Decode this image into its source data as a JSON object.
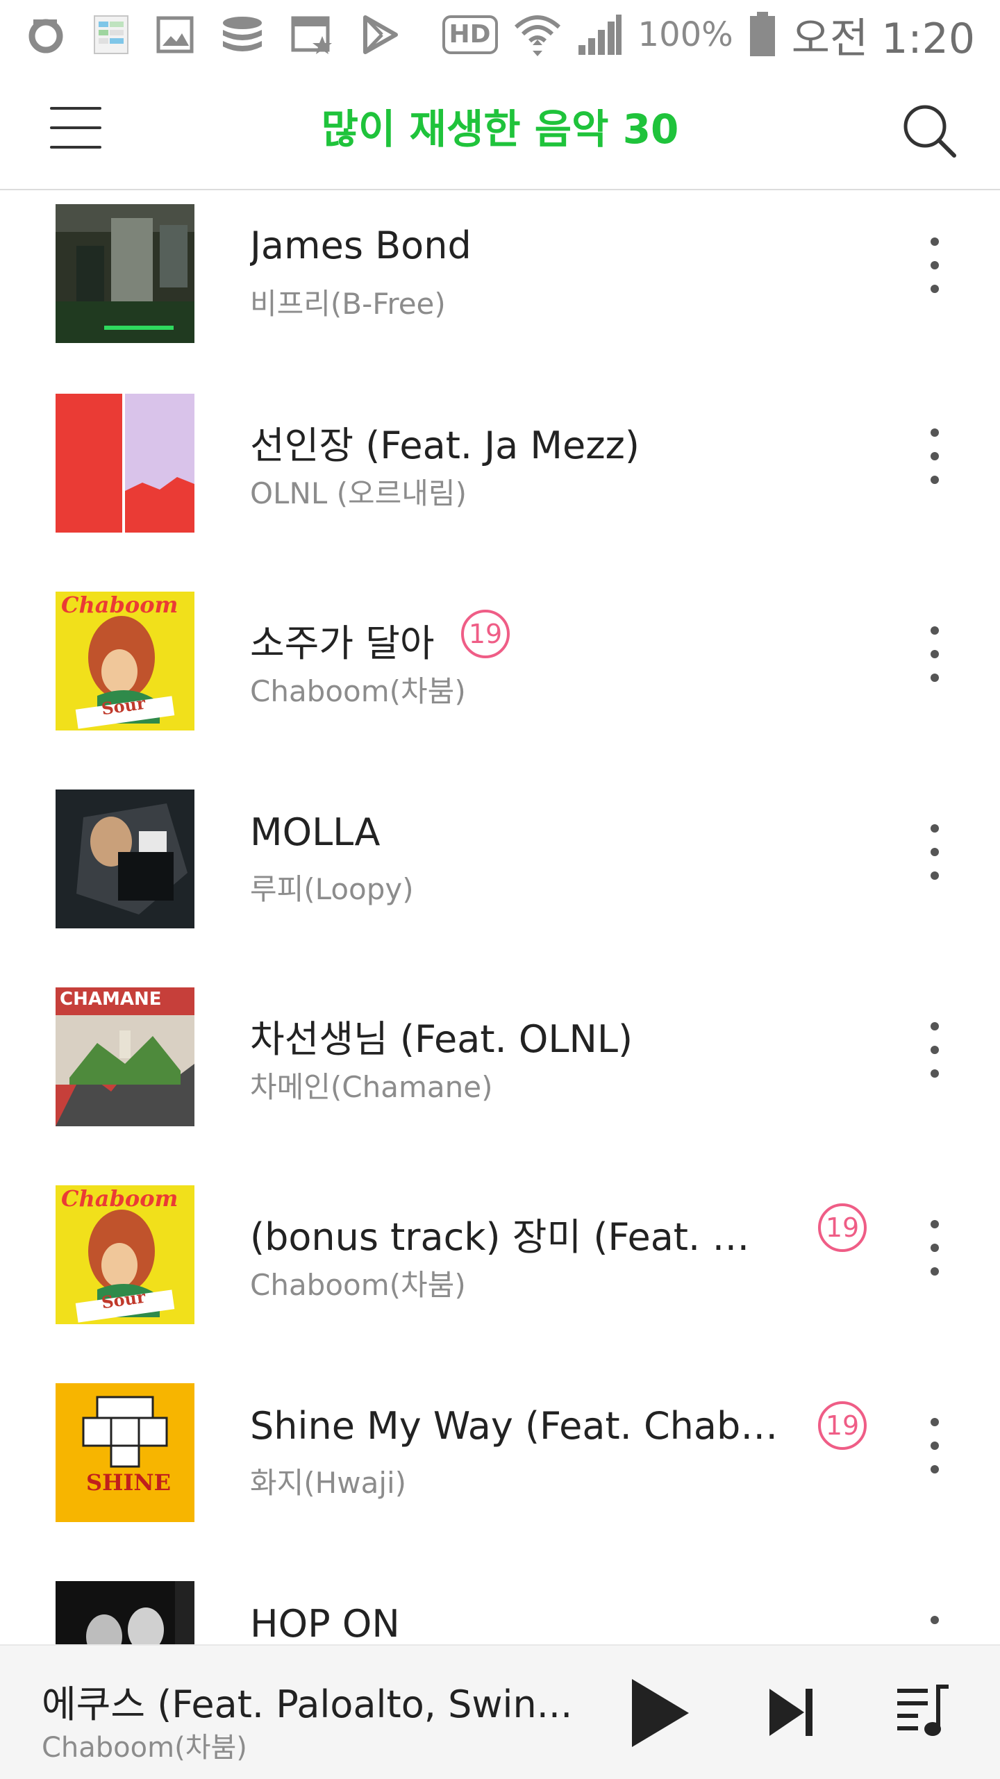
{
  "status_bar": {
    "battery": "100%",
    "time": "오전 1:20",
    "hd_label": "HD"
  },
  "header": {
    "title": "많이 재생한 음악 30"
  },
  "songs": [
    {
      "title": "James Bond",
      "artist": "비프리(B-Free)"
    },
    {
      "title": "선인장 (Feat. Ja Mezz)",
      "artist": "OLNL (오르내림)"
    },
    {
      "title": "소주가 달아",
      "artist": "Chaboom(차붐)",
      "badge": "19"
    },
    {
      "title": "MOLLA",
      "artist": "루피(Loopy)"
    },
    {
      "title": "차선생님 (Feat. OLNL)",
      "artist": "차메인(Chamane)"
    },
    {
      "title": "(bonus track) 장미 (Feat. 뱃...",
      "artist": "Chaboom(차붐)",
      "badge": "19"
    },
    {
      "title": "Shine My Way (Feat. Chabo...",
      "artist": "화지(Hwaji)",
      "badge": "19"
    },
    {
      "title": "HOP ON",
      "artist": ""
    }
  ],
  "covers": {
    "chaboom": "Chaboom",
    "sour": "Sour",
    "chamane": "CHAMANE",
    "shine": "SHINE"
  },
  "now_playing": {
    "title": "에쿠스 (Feat. Paloalto, Swin...",
    "artist": "Chaboom(차붐)"
  },
  "colors": {
    "accent": "#1fc33b",
    "adult_badge": "#ef5d86"
  }
}
